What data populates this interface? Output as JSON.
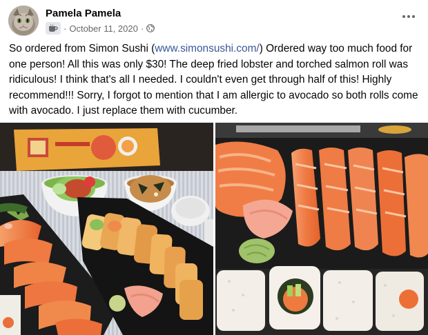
{
  "post": {
    "author": "Pamela Pamela",
    "date": "October 11, 2020",
    "separator": "·",
    "text_before_link": "So ordered from Simon Sushi (",
    "link_text": "www.simonsushi.com/",
    "text_after_link": ")  Ordered way too much food for one person! All this was only $30! The deep fried lobster and torched salmon roll was ridiculous! I think that's all I needed. I couldn't even get through half of this! Highly recommend!!! Sorry, I forgot to mention that I am allergic to avocado so both rolls come with avocado. I just replace them with cucumber."
  },
  "icons": {
    "avatar": "cat-avatar",
    "group": "coffee-cup-icon",
    "privacy": "globe-icon",
    "more": "more-options-icon"
  },
  "colors": {
    "link": "#385898",
    "meta": "#65676b",
    "salmon": "#f07a45"
  }
}
